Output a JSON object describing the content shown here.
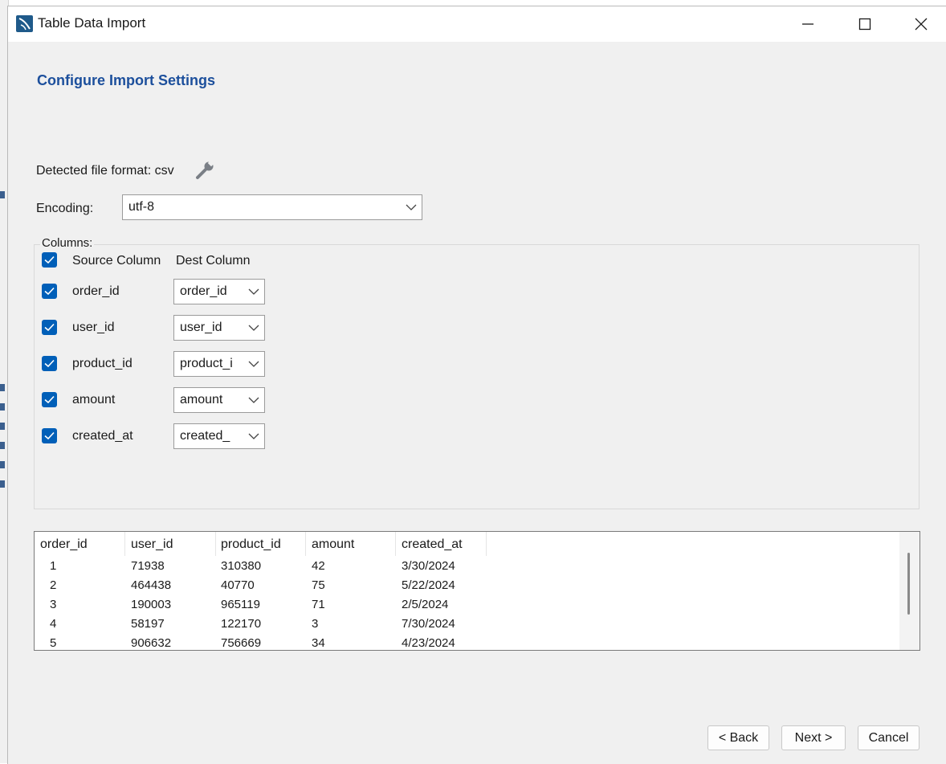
{
  "window": {
    "title": "Table Data Import"
  },
  "heading": "Configure Import Settings",
  "file_format": {
    "label": "Detected file format: csv"
  },
  "encoding": {
    "label": "Encoding:",
    "value": "utf-8"
  },
  "columns": {
    "legend": "Columns:",
    "header_source": "Source Column",
    "header_dest": "Dest Column",
    "rows": [
      {
        "source": "order_id",
        "dest": "order_id",
        "checked": true
      },
      {
        "source": "user_id",
        "dest": "user_id",
        "checked": true
      },
      {
        "source": "product_id",
        "dest": "product_i",
        "checked": true
      },
      {
        "source": "amount",
        "dest": "amount",
        "checked": true
      },
      {
        "source": "created_at",
        "dest": "created_",
        "checked": true
      }
    ]
  },
  "preview": {
    "headers": [
      "order_id",
      "user_id",
      "product_id",
      "amount",
      "created_at"
    ],
    "rows": [
      [
        "1",
        "71938",
        "310380",
        "42",
        "3/30/2024"
      ],
      [
        "2",
        "464438",
        "40770",
        "75",
        "5/22/2024"
      ],
      [
        "3",
        "190003",
        "965119",
        "71",
        "2/5/2024"
      ],
      [
        "4",
        "58197",
        "122170",
        "3",
        "7/30/2024"
      ],
      [
        "5",
        "906632",
        "756669",
        "34",
        "4/23/2024"
      ]
    ]
  },
  "buttons": {
    "back": "< Back",
    "next": "Next >",
    "cancel": "Cancel"
  },
  "colors": {
    "heading": "#1c4f9c",
    "checkbox": "#005fb8"
  }
}
